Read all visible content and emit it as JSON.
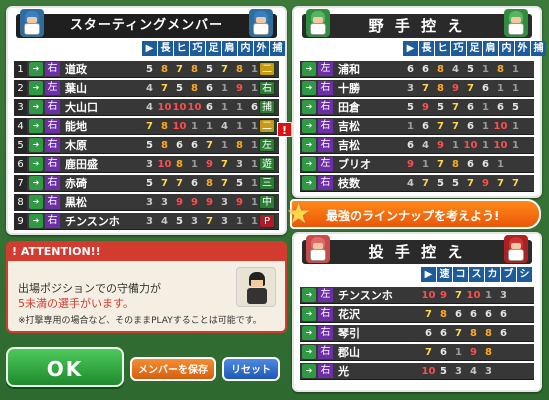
{
  "starting": {
    "title": "スターティングメンバー",
    "columns": [
      "長",
      "ヒ",
      "巧",
      "足",
      "肩",
      "内",
      "外",
      "捕"
    ],
    "rows": [
      {
        "num": "1",
        "hand": "右",
        "name": "道政",
        "stats": [
          "5",
          "8",
          "7",
          "8",
          "5",
          "7",
          "8",
          "1"
        ],
        "pos": "二"
      },
      {
        "num": "2",
        "hand": "左",
        "name": "葉山",
        "stats": [
          "4",
          "7",
          "5",
          "8",
          "6",
          "1",
          "9",
          "1"
        ],
        "pos": "右"
      },
      {
        "num": "3",
        "hand": "右",
        "name": "大山口",
        "stats": [
          "4",
          "10",
          "10",
          "10",
          "6",
          "1",
          "1",
          "6"
        ],
        "pos": "捕"
      },
      {
        "num": "4",
        "hand": "右",
        "name": "能地",
        "stats": [
          "7",
          "8",
          "10",
          "1",
          "1",
          "4",
          "1",
          "1"
        ],
        "pos": "二"
      },
      {
        "num": "5",
        "hand": "右",
        "name": "木原",
        "stats": [
          "5",
          "8",
          "6",
          "6",
          "7",
          "1",
          "8",
          "1"
        ],
        "pos": "左"
      },
      {
        "num": "6",
        "hand": "右",
        "name": "鹿田盛",
        "stats": [
          "3",
          "10",
          "8",
          "1",
          "9",
          "7",
          "3",
          "1"
        ],
        "pos": "遊"
      },
      {
        "num": "7",
        "hand": "右",
        "name": "赤碕",
        "stats": [
          "5",
          "7",
          "7",
          "6",
          "8",
          "7",
          "5",
          "1"
        ],
        "pos": "三"
      },
      {
        "num": "8",
        "hand": "右",
        "name": "黒松",
        "stats": [
          "3",
          "3",
          "9",
          "9",
          "9",
          "3",
          "9",
          "1"
        ],
        "pos": "中"
      },
      {
        "num": "9",
        "hand": "右",
        "name": "チンスンホ",
        "stats": [
          "3",
          "4",
          "5",
          "3",
          "7",
          "3",
          "1",
          "1"
        ],
        "pos": "P"
      }
    ]
  },
  "bench_fielders": {
    "title": "野 手 控 え",
    "columns": [
      "長",
      "ヒ",
      "巧",
      "足",
      "肩",
      "内",
      "外",
      "捕"
    ],
    "rows": [
      {
        "hand": "左",
        "name": "浦和",
        "stats": [
          "6",
          "6",
          "8",
          "4",
          "5",
          "1",
          "8",
          "1"
        ]
      },
      {
        "hand": "右",
        "name": "十勝",
        "stats": [
          "3",
          "7",
          "8",
          "9",
          "7",
          "6",
          "1",
          "1"
        ]
      },
      {
        "hand": "右",
        "name": "田倉",
        "stats": [
          "5",
          "9",
          "5",
          "7",
          "6",
          "1",
          "6",
          "5"
        ]
      },
      {
        "hand": "右",
        "name": "吉松",
        "stats": [
          "1",
          "6",
          "7",
          "7",
          "6",
          "1",
          "10",
          "1"
        ]
      },
      {
        "hand": "右",
        "name": "吉松",
        "stats": [
          "6",
          "4",
          "9",
          "1",
          "10",
          "1",
          "10",
          "1"
        ]
      },
      {
        "hand": "左",
        "name": "ブリオ",
        "stats": [
          "9",
          "1",
          "7",
          "8",
          "6",
          "6",
          "1"
        ]
      },
      {
        "hand": "右",
        "name": "枝数",
        "stats": [
          "4",
          "7",
          "5",
          "5",
          "7",
          "9",
          "7",
          "7"
        ]
      }
    ]
  },
  "bench_pitchers": {
    "title": "投 手 控 え",
    "columns": [
      "速",
      "コ",
      "ス",
      "カ",
      "ブ",
      "シ"
    ],
    "rows": [
      {
        "hand": "左",
        "name": "チンスンホ",
        "stats": [
          "10",
          "9",
          "7",
          "10",
          "1",
          "3"
        ]
      },
      {
        "hand": "右",
        "name": "花沢",
        "stats": [
          "7",
          "8",
          "6",
          "6",
          "6",
          "6"
        ]
      },
      {
        "hand": "右",
        "name": "琴引",
        "stats": [
          "6",
          "6",
          "7",
          "8",
          "8",
          "6"
        ]
      },
      {
        "hand": "右",
        "name": "郡山",
        "stats": [
          "7",
          "6",
          "1",
          "9",
          "8"
        ]
      },
      {
        "hand": "右",
        "name": "光",
        "stats": [
          "10",
          "5",
          "3",
          "4",
          "3"
        ]
      }
    ]
  },
  "banner": "最強のラインナップを考えよう!",
  "attention": {
    "title": "ATTENTION!!",
    "line1": "出場ポジションでの守備力が",
    "line2": "5未満の選手がいます。",
    "line3": "※打撃専用の場合など、そのままPLAYすることは可能です。"
  },
  "buttons": {
    "ok": "OK",
    "save": "メンバーを保存",
    "reset": "リセット"
  },
  "colors": {
    "hand_bg": "#6c2fa8",
    "column_header": "#1c5c9b",
    "accent_orange": "#ea5608",
    "warning_red": "#d43b2f",
    "ok_green": "#1e8a2d"
  }
}
